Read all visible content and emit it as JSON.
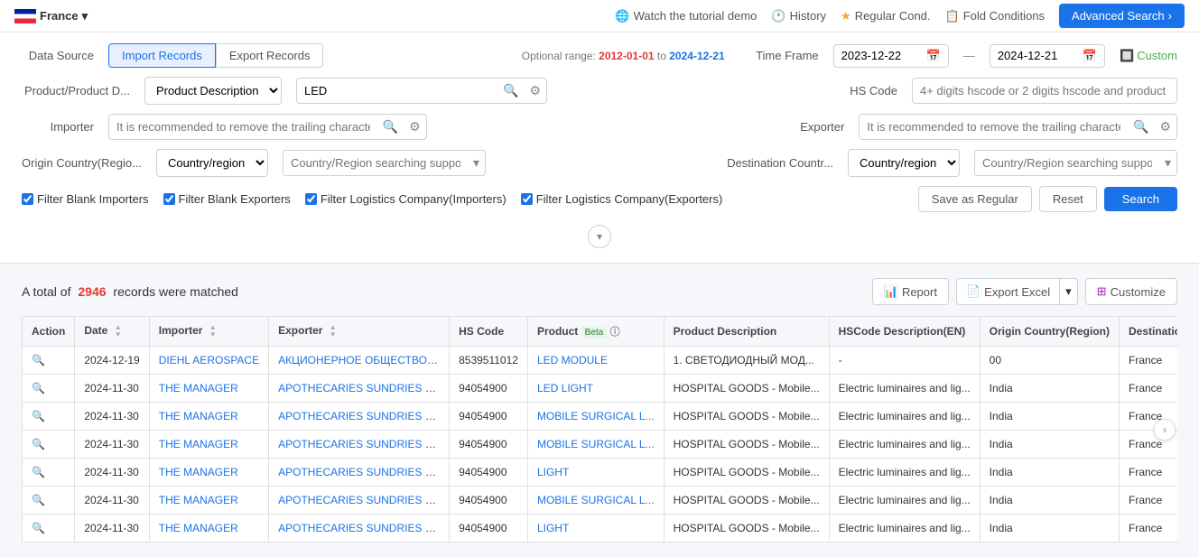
{
  "topNav": {
    "country": "France",
    "watchTutorial": "Watch the tutorial demo",
    "history": "History",
    "regularCond": "Regular Cond.",
    "foldConditions": "Fold Conditions",
    "advancedSearch": "Advanced Search"
  },
  "searchForm": {
    "dataSourceLabel": "Data Source",
    "importRecords": "Import Records",
    "exportRecords": "Export Records",
    "optionalRange": "Optional range:",
    "dateRangeStart": "2012-01-01",
    "dateRangeTo": "to",
    "dateRangeEnd": "2024-12-21",
    "timeFrameLabel": "Time Frame",
    "timeFrameStart": "2023-12-22",
    "timeFrameEnd": "2024-12-21",
    "customLabel": "Custom",
    "productLabel": "Product/Product D...",
    "productDropdown": "Product Description",
    "productValue": "LED",
    "hsCodeLabel": "HS Code",
    "hsCodePlaceholder": "4+ digits hscode or 2 digits hscode and product description/company name",
    "importerLabel": "Importer",
    "importerPlaceholder": "It is recommended to remove the trailing characters or special symbols of the company",
    "exporterLabel": "Exporter",
    "exporterPlaceholder": "It is recommended to remove the trailing characters or special symbols of the company",
    "originCountryLabel": "Origin Country(Regio...",
    "originCountryDropdown": "Country/region",
    "originCountryPlaceholder": "Country/Region searching supported",
    "destCountryLabel": "Destination Countr...",
    "destCountryDropdown": "Country/region",
    "destCountryPlaceholder": "Country/Region searching supported",
    "filterBlankImporters": "Filter Blank Importers",
    "filterBlankExporters": "Filter Blank Exporters",
    "filterLogisticsImporters": "Filter Logistics Company(Importers)",
    "filterLogisticsExporters": "Filter Logistics Company(Exporters)",
    "saveAsRegular": "Save as Regular",
    "reset": "Reset",
    "search": "Search"
  },
  "results": {
    "totalText": "A total of",
    "count": "2946",
    "recordsText": "records were matched",
    "reportBtn": "Report",
    "exportExcelBtn": "Export Excel",
    "customizeBtn": "Customize"
  },
  "table": {
    "columns": [
      "Action",
      "Date",
      "Importer",
      "Exporter",
      "HS Code",
      "Product Beta",
      "Product Description",
      "HSCode Description(EN)",
      "Origin Country(Region)",
      "Destination Country(Regi..."
    ],
    "rows": [
      {
        "date": "2024-12-19",
        "importer": "DIEHL AEROSPACE",
        "exporter": "АКЦИОНЕРНОЕ ОБЩЕСТВО ЭЙР А...",
        "hsCode": "8539511012",
        "product": "LED MODULE",
        "productDesc": "1. СВЕТОДИОДНЫЙ МОД...",
        "hscodeDesc": "-",
        "originCountry": "00",
        "destCountry": "France"
      },
      {
        "date": "2024-11-30",
        "importer": "THE MANAGER",
        "exporter": "APOTHECARIES SUNDRIES MFG PRI...",
        "hsCode": "94054900",
        "product": "LED LIGHT",
        "productDesc": "HOSPITAL GOODS - Mobile...",
        "hscodeDesc": "Electric luminaires and lig...",
        "originCountry": "India",
        "destCountry": "France"
      },
      {
        "date": "2024-11-30",
        "importer": "THE MANAGER",
        "exporter": "APOTHECARIES SUNDRIES MFG PRI...",
        "hsCode": "94054900",
        "product": "MOBILE SURGICAL L...",
        "productDesc": "HOSPITAL GOODS - Mobile...",
        "hscodeDesc": "Electric luminaires and lig...",
        "originCountry": "India",
        "destCountry": "France"
      },
      {
        "date": "2024-11-30",
        "importer": "THE MANAGER",
        "exporter": "APOTHECARIES SUNDRIES MFG PRI...",
        "hsCode": "94054900",
        "product": "MOBILE SURGICAL L...",
        "productDesc": "HOSPITAL GOODS - Mobile...",
        "hscodeDesc": "Electric luminaires and lig...",
        "originCountry": "India",
        "destCountry": "France"
      },
      {
        "date": "2024-11-30",
        "importer": "THE MANAGER",
        "exporter": "APOTHECARIES SUNDRIES MFG PRI...",
        "hsCode": "94054900",
        "product": "LIGHT",
        "productDesc": "HOSPITAL GOODS - Mobile...",
        "hscodeDesc": "Electric luminaires and lig...",
        "originCountry": "India",
        "destCountry": "France"
      },
      {
        "date": "2024-11-30",
        "importer": "THE MANAGER",
        "exporter": "APOTHECARIES SUNDRIES MFG PRI...",
        "hsCode": "94054900",
        "product": "MOBILE SURGICAL L...",
        "productDesc": "HOSPITAL GOODS - Mobile...",
        "hscodeDesc": "Electric luminaires and lig...",
        "originCountry": "India",
        "destCountry": "France"
      },
      {
        "date": "2024-11-30",
        "importer": "THE MANAGER",
        "exporter": "APOTHECARIES SUNDRIES MFG PRI...",
        "hsCode": "94054900",
        "product": "LIGHT",
        "productDesc": "HOSPITAL GOODS - Mobile...",
        "hscodeDesc": "Electric luminaires and lig...",
        "originCountry": "India",
        "destCountry": "France"
      }
    ]
  }
}
